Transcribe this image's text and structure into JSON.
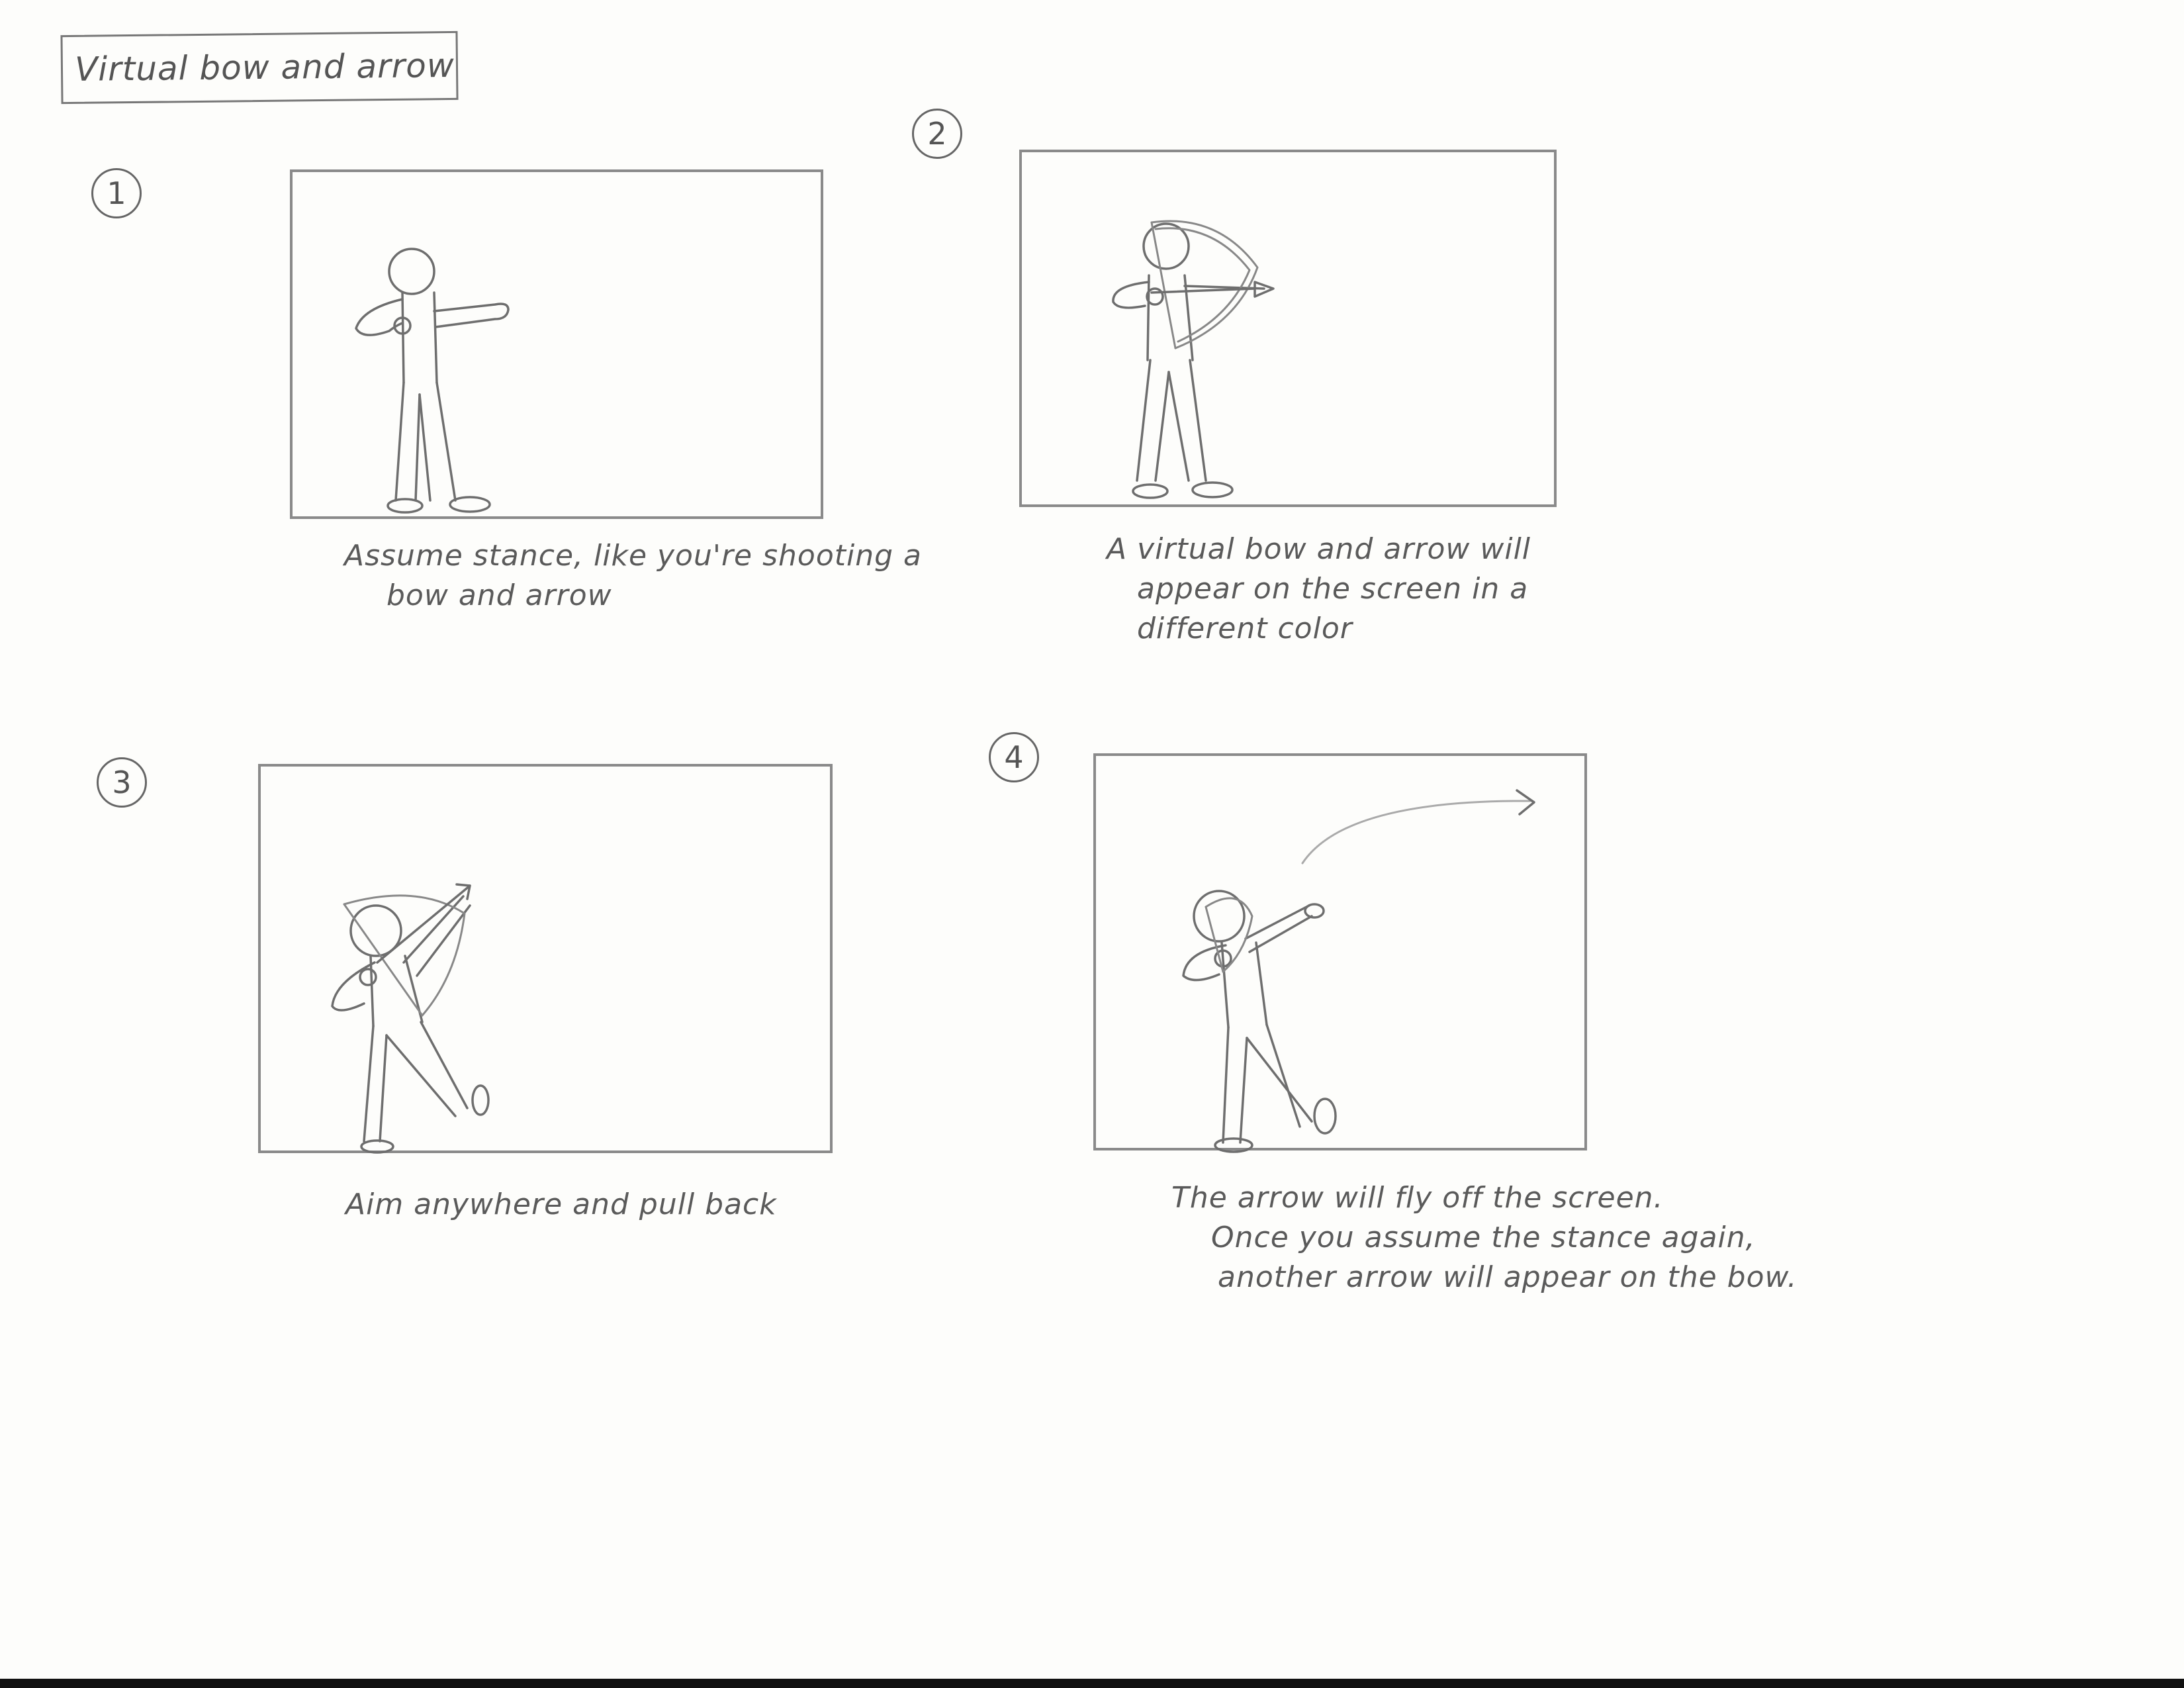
{
  "title": "Virtual bow and arrow",
  "panels": [
    {
      "number": "1",
      "caption_lines": [
        "Assume stance, like you're shooting a",
        "bow and arrow"
      ]
    },
    {
      "number": "2",
      "caption_lines": [
        "A virtual bow and arrow will",
        "appear on the screen in a",
        "different color"
      ]
    },
    {
      "number": "3",
      "caption_lines": [
        "Aim anywhere and pull back"
      ]
    },
    {
      "number": "4",
      "caption_lines": [
        "The arrow will fly off the screen.",
        "Once you assume the stance again,",
        "another arrow will appear on the bow."
      ]
    }
  ]
}
